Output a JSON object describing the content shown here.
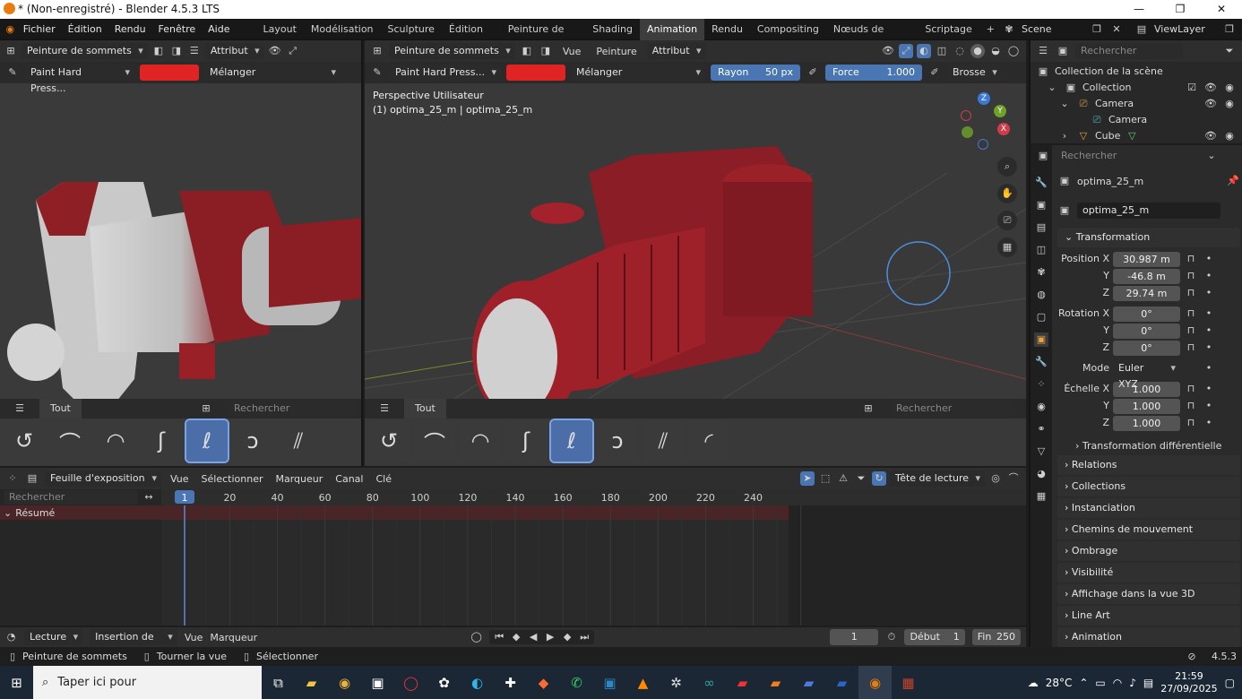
{
  "title_bar": {
    "title": "* (Non-enregistré) - Blender 4.5.3 LTS",
    "minimize": "—",
    "maximize": "❐",
    "close": "✕"
  },
  "menu": {
    "items": [
      "Fichier",
      "Édition",
      "Rendu",
      "Fenêtre",
      "Aide"
    ]
  },
  "workspaces": {
    "tabs": [
      "Layout",
      "Modélisation",
      "Sculpture",
      "Édition d'UV",
      "Peinture de texture",
      "Shading",
      "Animation",
      "Rendu",
      "Compositing",
      "Nœuds de géométrie",
      "Scriptage"
    ],
    "active": "Animation",
    "add": "+"
  },
  "scene": {
    "name": "Scene",
    "view_layer": "ViewLayer"
  },
  "left_viewport": {
    "mode": "Peinture de sommets",
    "attribute_label": "Attribut",
    "brush_name": "Paint Hard Press...",
    "blend": "Mélanger",
    "asset_tab": "Tout",
    "search_placeholder": "Rechercher"
  },
  "main_viewport": {
    "mode": "Peinture de sommets",
    "menus": [
      "Vue",
      "Peinture",
      "Attribut"
    ],
    "brush_name": "Paint Hard Press...",
    "blend": "Mélanger",
    "radius_label": "Rayon",
    "radius_value": "50 px",
    "strength_label": "Force",
    "strength_value": "1.000",
    "brush_menu": "Brosse",
    "overlay_line1": "Perspective Utilisateur",
    "overlay_line2": "(1) optima_25_m | optima_25_m",
    "asset_tab": "Tout",
    "search_placeholder": "Rechercher",
    "gizmo": {
      "z": "Z",
      "y": "Y",
      "x": "X"
    }
  },
  "outliner": {
    "search_placeholder": "Rechercher",
    "items": [
      {
        "label": "Collection de la scène"
      },
      {
        "label": "Collection"
      },
      {
        "label": "Camera"
      },
      {
        "label": "Camera"
      },
      {
        "label": "Cube"
      }
    ]
  },
  "properties": {
    "search_placeholder": "Rechercher",
    "object_name": "optima_25_m",
    "object_field": "optima_25_m",
    "transform_title": "Transformation",
    "position_label": "Position X",
    "position": [
      "30.987 m",
      "-46.8 m",
      "29.74 m"
    ],
    "rotation_label": "Rotation X",
    "rotation": [
      "0°",
      "0°",
      "0°"
    ],
    "mode_label": "Mode",
    "mode_value": "Euler XYZ",
    "scale_label": "Échelle X",
    "scale": [
      "1.000",
      "1.000",
      "1.000"
    ],
    "axis_y": "Y",
    "axis_z": "Z",
    "delta": "Transformation différentielle",
    "panels": [
      "Relations",
      "Collections",
      "Instanciation",
      "Chemins de mouvement",
      "Ombrage",
      "Visibilité",
      "Affichage dans la vue 3D",
      "Line Art",
      "Animation"
    ]
  },
  "timeline": {
    "editor": "Feuille d'exposition",
    "menus": [
      "Vue",
      "Sélectionner",
      "Marqueur",
      "Canal",
      "Clé"
    ],
    "playhead_label": "Tête de lecture",
    "search_placeholder": "Rechercher",
    "summary": "Résumé",
    "current_frame_marker": "1",
    "ticks": [
      "20",
      "40",
      "60",
      "80",
      "100",
      "120",
      "140",
      "160",
      "180",
      "200",
      "220",
      "240"
    ]
  },
  "playback": {
    "menus": [
      "Lecture",
      "Insertion de clés",
      "Vue",
      "Marqueur"
    ],
    "current_frame": "1",
    "start_label": "Début",
    "start": "1",
    "end_label": "Fin",
    "end": "250"
  },
  "status_bar": {
    "items": [
      "Peinture de sommets",
      "Tourner la vue",
      "Sélectionner"
    ],
    "version": "4.5.3"
  },
  "taskbar": {
    "search_placeholder": "Taper ici pour",
    "temperature": "28°C",
    "time": "21:59",
    "date": "27/09/2025"
  },
  "colors": {
    "accent_blue": "#4a76b3",
    "paint_red": "#e02424",
    "active_orange": "#e87d0d"
  }
}
